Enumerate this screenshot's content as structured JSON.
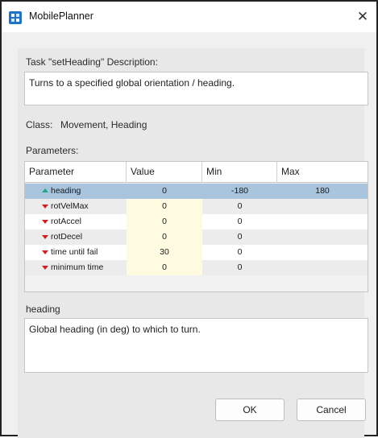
{
  "window": {
    "title": "MobilePlanner",
    "close_glyph": "✕"
  },
  "task": {
    "description_label": "Task \"setHeading\" Description:",
    "description": "Turns to a specified global orientation / heading.",
    "class_label": "Class:",
    "class_value": "Movement, Heading"
  },
  "parameters": {
    "label": "Parameters:",
    "columns": [
      "Parameter",
      "Value",
      "Min",
      "Max"
    ],
    "rows": [
      {
        "name": "heading",
        "value": "0",
        "min": "-180",
        "max": "180",
        "icon": "triangle-up-green-icon",
        "selected": true
      },
      {
        "name": "rotVelMax",
        "value": "0",
        "min": "0",
        "max": "",
        "icon": "triangle-down-red-icon",
        "selected": false
      },
      {
        "name": "rotAccel",
        "value": "0",
        "min": "0",
        "max": "",
        "icon": "triangle-down-red-icon",
        "selected": false
      },
      {
        "name": "rotDecel",
        "value": "0",
        "min": "0",
        "max": "",
        "icon": "triangle-down-red-icon",
        "selected": false
      },
      {
        "name": "time until fail",
        "value": "30",
        "min": "0",
        "max": "",
        "icon": "triangle-down-red-icon",
        "selected": false
      },
      {
        "name": "minimum time",
        "value": "0",
        "min": "0",
        "max": "",
        "icon": "triangle-down-red-icon",
        "selected": false
      }
    ]
  },
  "param_detail": {
    "name": "heading",
    "description": "Global heading (in deg) to which to turn."
  },
  "buttons": {
    "ok": "OK",
    "cancel": "Cancel"
  },
  "colors": {
    "selection": "#a9c4dd",
    "value_cell": "#fffbe0",
    "arrow_down": "#d42020",
    "arrow_up": "#1ea88a"
  }
}
